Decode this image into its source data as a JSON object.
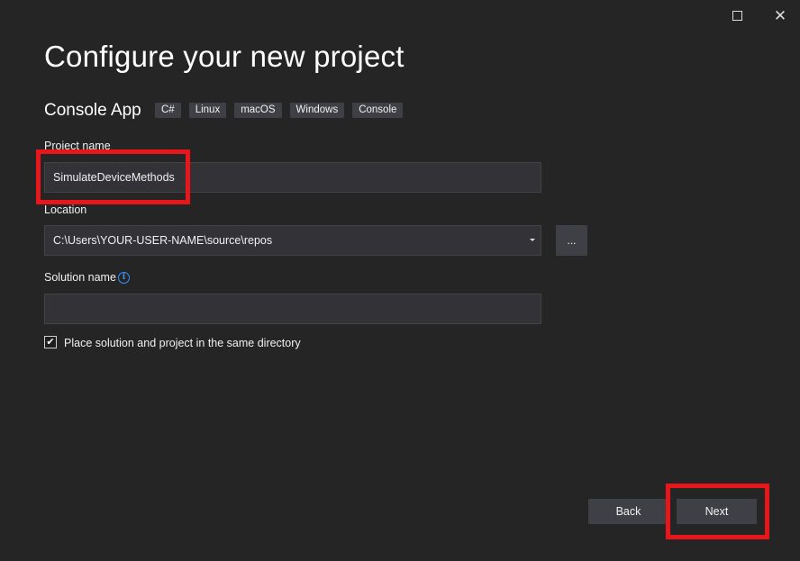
{
  "window": {
    "maximize_icon": "maximize-icon",
    "close_icon": "close-icon"
  },
  "page": {
    "title": "Configure your new project"
  },
  "template": {
    "name": "Console App",
    "tags": [
      "C#",
      "Linux",
      "macOS",
      "Windows",
      "Console"
    ]
  },
  "form": {
    "project_name_label": "Project name",
    "project_name_value": "SimulateDeviceMethods",
    "location_label": "Location",
    "location_value": "C:\\Users\\YOUR-USER-NAME\\source\\repos",
    "browse_label": "...",
    "solution_name_label": "Solution name",
    "solution_name_value": "",
    "same_directory_label": "Place solution and project in the same directory",
    "same_directory_checked": true
  },
  "buttons": {
    "back_label": "Back",
    "next_label": "Next"
  },
  "colors": {
    "background": "#252526",
    "input_bg": "#333337",
    "button_bg": "#3f3f46",
    "highlight": "#e8151a",
    "info": "#3794ff"
  }
}
